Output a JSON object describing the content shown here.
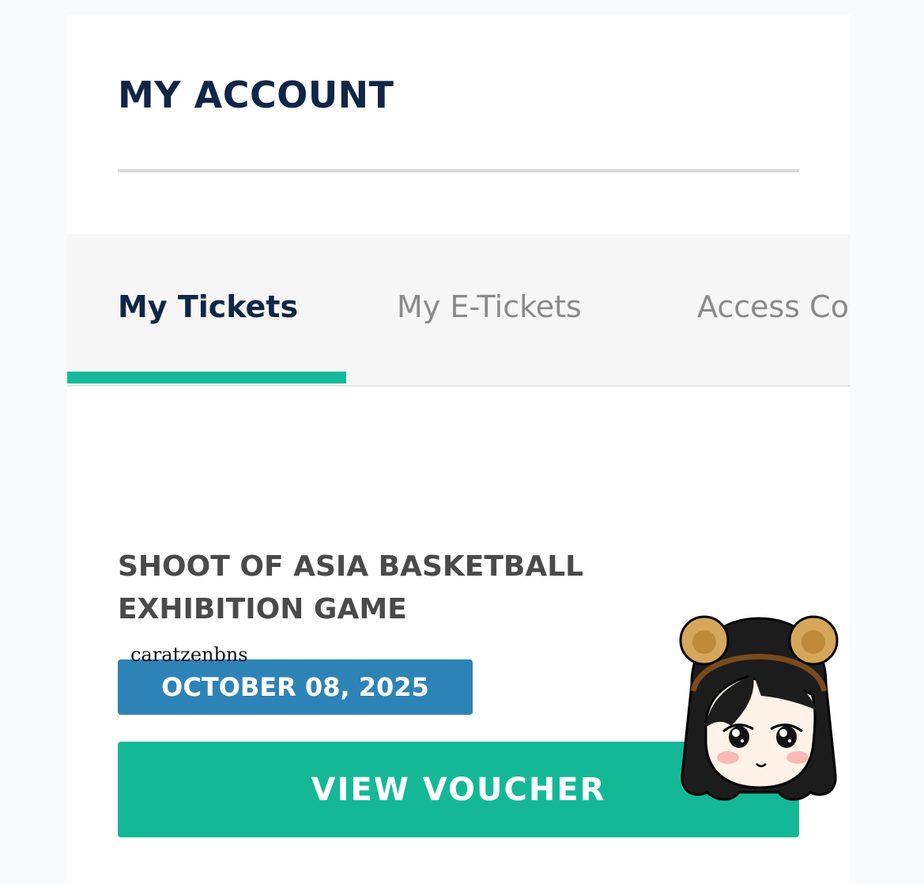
{
  "header": {
    "title": "MY ACCOUNT"
  },
  "tabs": [
    {
      "label": "My Tickets",
      "active": true
    },
    {
      "label": "My E-Tickets",
      "active": false
    },
    {
      "label": "Access Co",
      "active": false
    }
  ],
  "ticket": {
    "event_title": "SHOOT OF ASIA BASKETBALL EXHIBITION GAME",
    "date": "OCTOBER 08, 2025",
    "button_label": "VIEW VOUCHER"
  },
  "overlay": {
    "watermark_text": "caratzenbns"
  },
  "colors": {
    "navy": "#0f2647",
    "accent_green": "#14b897",
    "date_blue": "#2e83b6",
    "muted_tab": "#8a8a8a"
  }
}
